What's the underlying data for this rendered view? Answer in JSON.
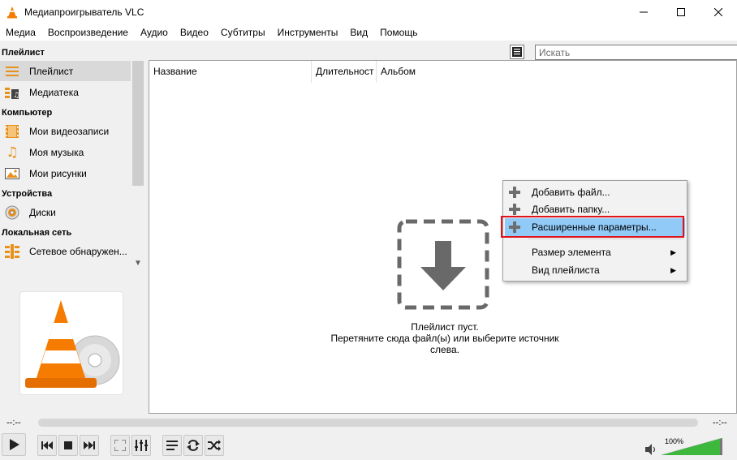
{
  "window": {
    "title": "Медиапроигрыватель VLC"
  },
  "menu": [
    "Медиа",
    "Воспроизведение",
    "Аудио",
    "Видео",
    "Субтитры",
    "Инструменты",
    "Вид",
    "Помощь"
  ],
  "sidebar": {
    "sections": [
      {
        "header": "Плейлист",
        "items": [
          "Плейлист",
          "Медиатека"
        ]
      },
      {
        "header": "Компьютер",
        "items": [
          "Мои видеозаписи",
          "Моя музыка",
          "Мои рисунки"
        ]
      },
      {
        "header": "Устройства",
        "items": [
          "Диски"
        ]
      },
      {
        "header": "Локальная сеть",
        "items": [
          "Сетевое обнаружен..."
        ]
      }
    ],
    "selected": "Плейлист"
  },
  "search": {
    "placeholder": "Искать"
  },
  "playlist": {
    "columns": [
      "Название",
      "Длительност",
      "Альбом"
    ],
    "empty_line1": "Плейлист пуст.",
    "empty_line2": "Перетяните сюда файл(ы) или выберите источник слева."
  },
  "context_menu": {
    "items": [
      "Добавить файл...",
      "Добавить папку...",
      "Расширенные параметры...",
      "Размер элемента",
      "Вид плейлиста"
    ],
    "highlighted": "Расширенные параметры..."
  },
  "player": {
    "time_elapsed": "--:--",
    "time_total": "--:--",
    "volume": "100%",
    "volume_level": 1.0
  },
  "colors": {
    "accent_orange": "#f57c00",
    "highlight": "#91c9f7",
    "frame_red": "#e0121a",
    "volume_green": "#3db83d"
  }
}
